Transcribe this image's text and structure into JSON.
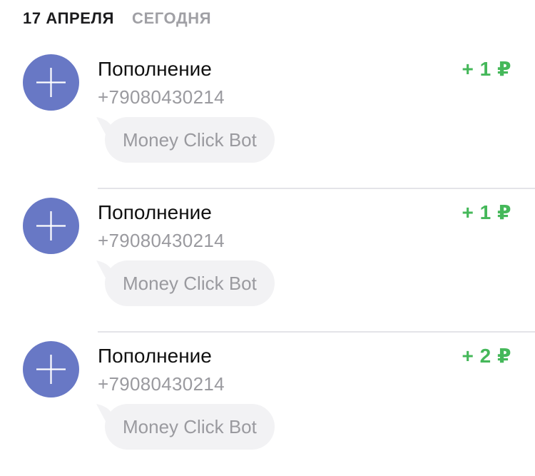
{
  "date_header": {
    "date": "17 АПРЕЛЯ",
    "relative": "СЕГОДНЯ"
  },
  "transactions": [
    {
      "icon": "plus-icon",
      "title": "Пополнение",
      "phone": "+79080430214",
      "comment": "Money Click Bot",
      "amount": "+ 1 ₽"
    },
    {
      "icon": "plus-icon",
      "title": "Пополнение",
      "phone": "+79080430214",
      "comment": "Money Click Bot",
      "amount": "+ 1 ₽"
    },
    {
      "icon": "plus-icon",
      "title": "Пополнение",
      "phone": "+79080430214",
      "comment": "Money Click Bot",
      "amount": "+ 2 ₽"
    }
  ],
  "colors": {
    "avatar_bg": "#6878c5",
    "amount_positive": "#45b85a",
    "secondary_text": "#9a9a9f",
    "bubble_bg": "#f2f2f4"
  }
}
